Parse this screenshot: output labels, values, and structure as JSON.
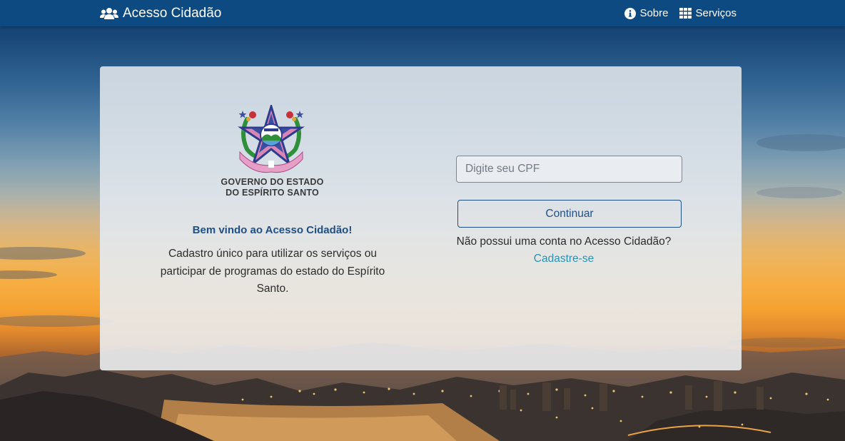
{
  "navbar": {
    "brand": "Acesso Cidadão",
    "links": [
      {
        "label": "Sobre",
        "icon": "info-circle-icon"
      },
      {
        "label": "Serviços",
        "icon": "grid-icon"
      }
    ]
  },
  "card": {
    "seal_caption_line1": "GOVERNO DO ESTADO",
    "seal_caption_line2": "DO ESPÍRITO SANTO",
    "welcome": "Bem vindo ao Acesso Cidadão!",
    "description": "Cadastro único para utilizar os serviços ou participar de programas do estado do Espírito Santo.",
    "cpf_placeholder": "Digite seu CPF",
    "continue_label": "Continuar",
    "no_account_text": "Não possui uma conta no Acesso Cidadão?",
    "signup_label": "Cadastre-se"
  },
  "colors": {
    "navbar": "#0d4a82",
    "accent": "#1f4f85",
    "link": "#2a93b5"
  }
}
